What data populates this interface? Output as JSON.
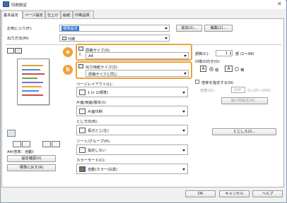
{
  "window": {
    "title": "印刷設定",
    "close": "✕"
  },
  "tabs": [
    "基本設定",
    "ページ設定",
    "仕上げ",
    "給紙",
    "印刷品質"
  ],
  "favorites": {
    "label": "お気に入り(F):",
    "value": "標準設定",
    "add_button": "追加(1)...",
    "edit_button": "編集(2)..."
  },
  "output_method": {
    "label": "出力方法(M):",
    "value": "印刷"
  },
  "paper_size": {
    "label": "原稿サイズ(S):",
    "value": "A4"
  },
  "output_size": {
    "label": "出力用紙サイズ(Z):",
    "value": "原稿サイズと同じ"
  },
  "badges": {
    "a": "a",
    "b": "b"
  },
  "layout": {
    "label": "ページレイアウト(L):",
    "value": "1 in 1(標準)"
  },
  "duplex": {
    "label": "片面/両面/製本(I):",
    "value": "片面印刷"
  },
  "binding": {
    "label": "とじ方向(B):",
    "value": "長辺とじ(左)",
    "button": "とじしろ(I)..."
  },
  "sort": {
    "label": "ソート/グループ(H):",
    "value": "指定しない"
  },
  "color": {
    "label": "カラーモード(C):",
    "value": "自動(カラー/白黒)"
  },
  "copies": {
    "label": "部数(C):",
    "value": "1",
    "unit": "部 (1〜99)"
  },
  "orientation": {
    "label": "印刷の向き(O)",
    "portrait": "縦",
    "landscape": "横",
    "selected": "portrait"
  },
  "zoom": {
    "label": "倍率を指定する(N)",
    "ratio_label": "倍率(O):",
    "ratio_value": "100",
    "ratio_unit": "% (25〜200)"
  },
  "manual_scaling_button": "縮小時設定(R)...",
  "preview": {
    "caption": "A4(倍率：自動)",
    "confirm_button": "設定確認(V)",
    "restore_button": "標準に戻す(R)"
  },
  "footer": {
    "ok": "OK",
    "cancel": "キャンセル",
    "help": "ヘルプ"
  },
  "colors": {
    "accent_orange": "#f0a23b",
    "selection_blue": "#3079d6"
  }
}
